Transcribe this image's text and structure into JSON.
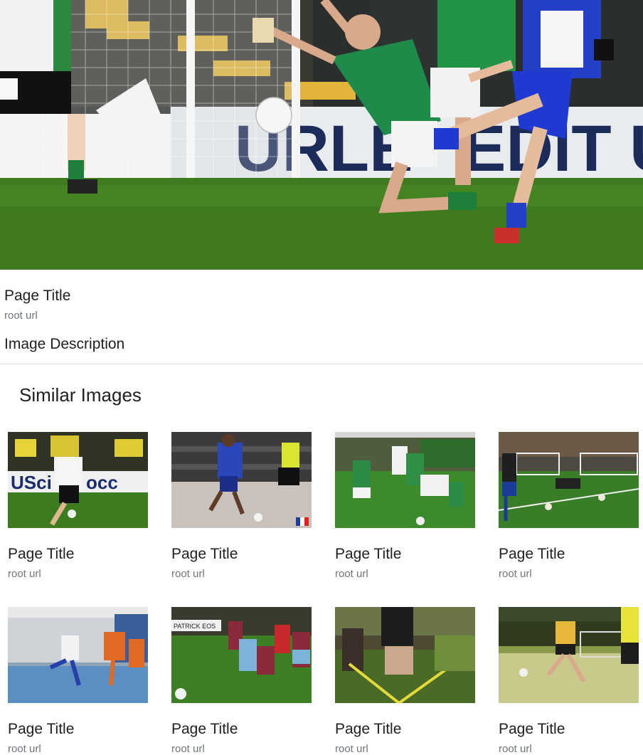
{
  "main": {
    "page_title": "Page Title",
    "root_url": "root url",
    "image_description": "Image Description"
  },
  "similar": {
    "heading": "Similar Images",
    "items": [
      {
        "title": "Page Title",
        "url": "root url"
      },
      {
        "title": "Page Title",
        "url": "root url"
      },
      {
        "title": "Page Title",
        "url": "root url"
      },
      {
        "title": "Page Title",
        "url": "root url"
      },
      {
        "title": "Page Title",
        "url": "root url"
      },
      {
        "title": "Page Title",
        "url": "root url"
      },
      {
        "title": "Page Title",
        "url": "root url"
      },
      {
        "title": "Page Title",
        "url": "root url"
      }
    ]
  }
}
